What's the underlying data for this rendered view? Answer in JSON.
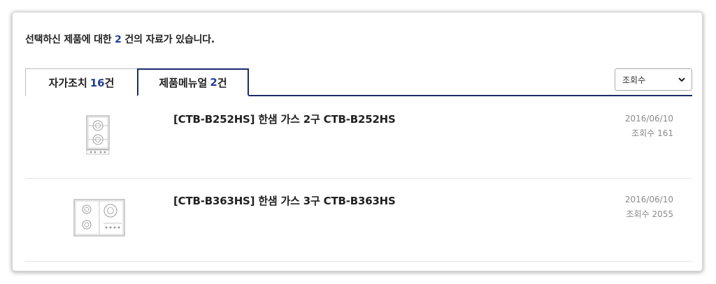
{
  "summary": {
    "prefix": "선택하신 제품에 대한",
    "count": "2",
    "suffix": "건의 자료가 있습니다."
  },
  "tabs": [
    {
      "label": "자가조치",
      "count": "16",
      "unit": "건",
      "active": false
    },
    {
      "label": "제품메뉴얼",
      "count": "2",
      "unit": "건",
      "active": true
    }
  ],
  "sort": {
    "selected": "조회수",
    "icon": "chevron-down-icon"
  },
  "items": [
    {
      "title": "[CTB-B252HS] 한샘 가스 2구 CTB-B252HS",
      "date": "2016/06/10",
      "views": "조회수 161",
      "thumbnail": "two-burner-cooktop-icon"
    },
    {
      "title": "[CTB-B363HS] 한샘 가스 3구 CTB-B363HS",
      "date": "2016/06/10",
      "views": "조회수 2055",
      "thumbnail": "three-burner-cooktop-icon"
    }
  ],
  "colors": {
    "accent": "#1f3f9e",
    "tab_border": "#1b2a6b",
    "meta_text": "#8a8a8a"
  }
}
